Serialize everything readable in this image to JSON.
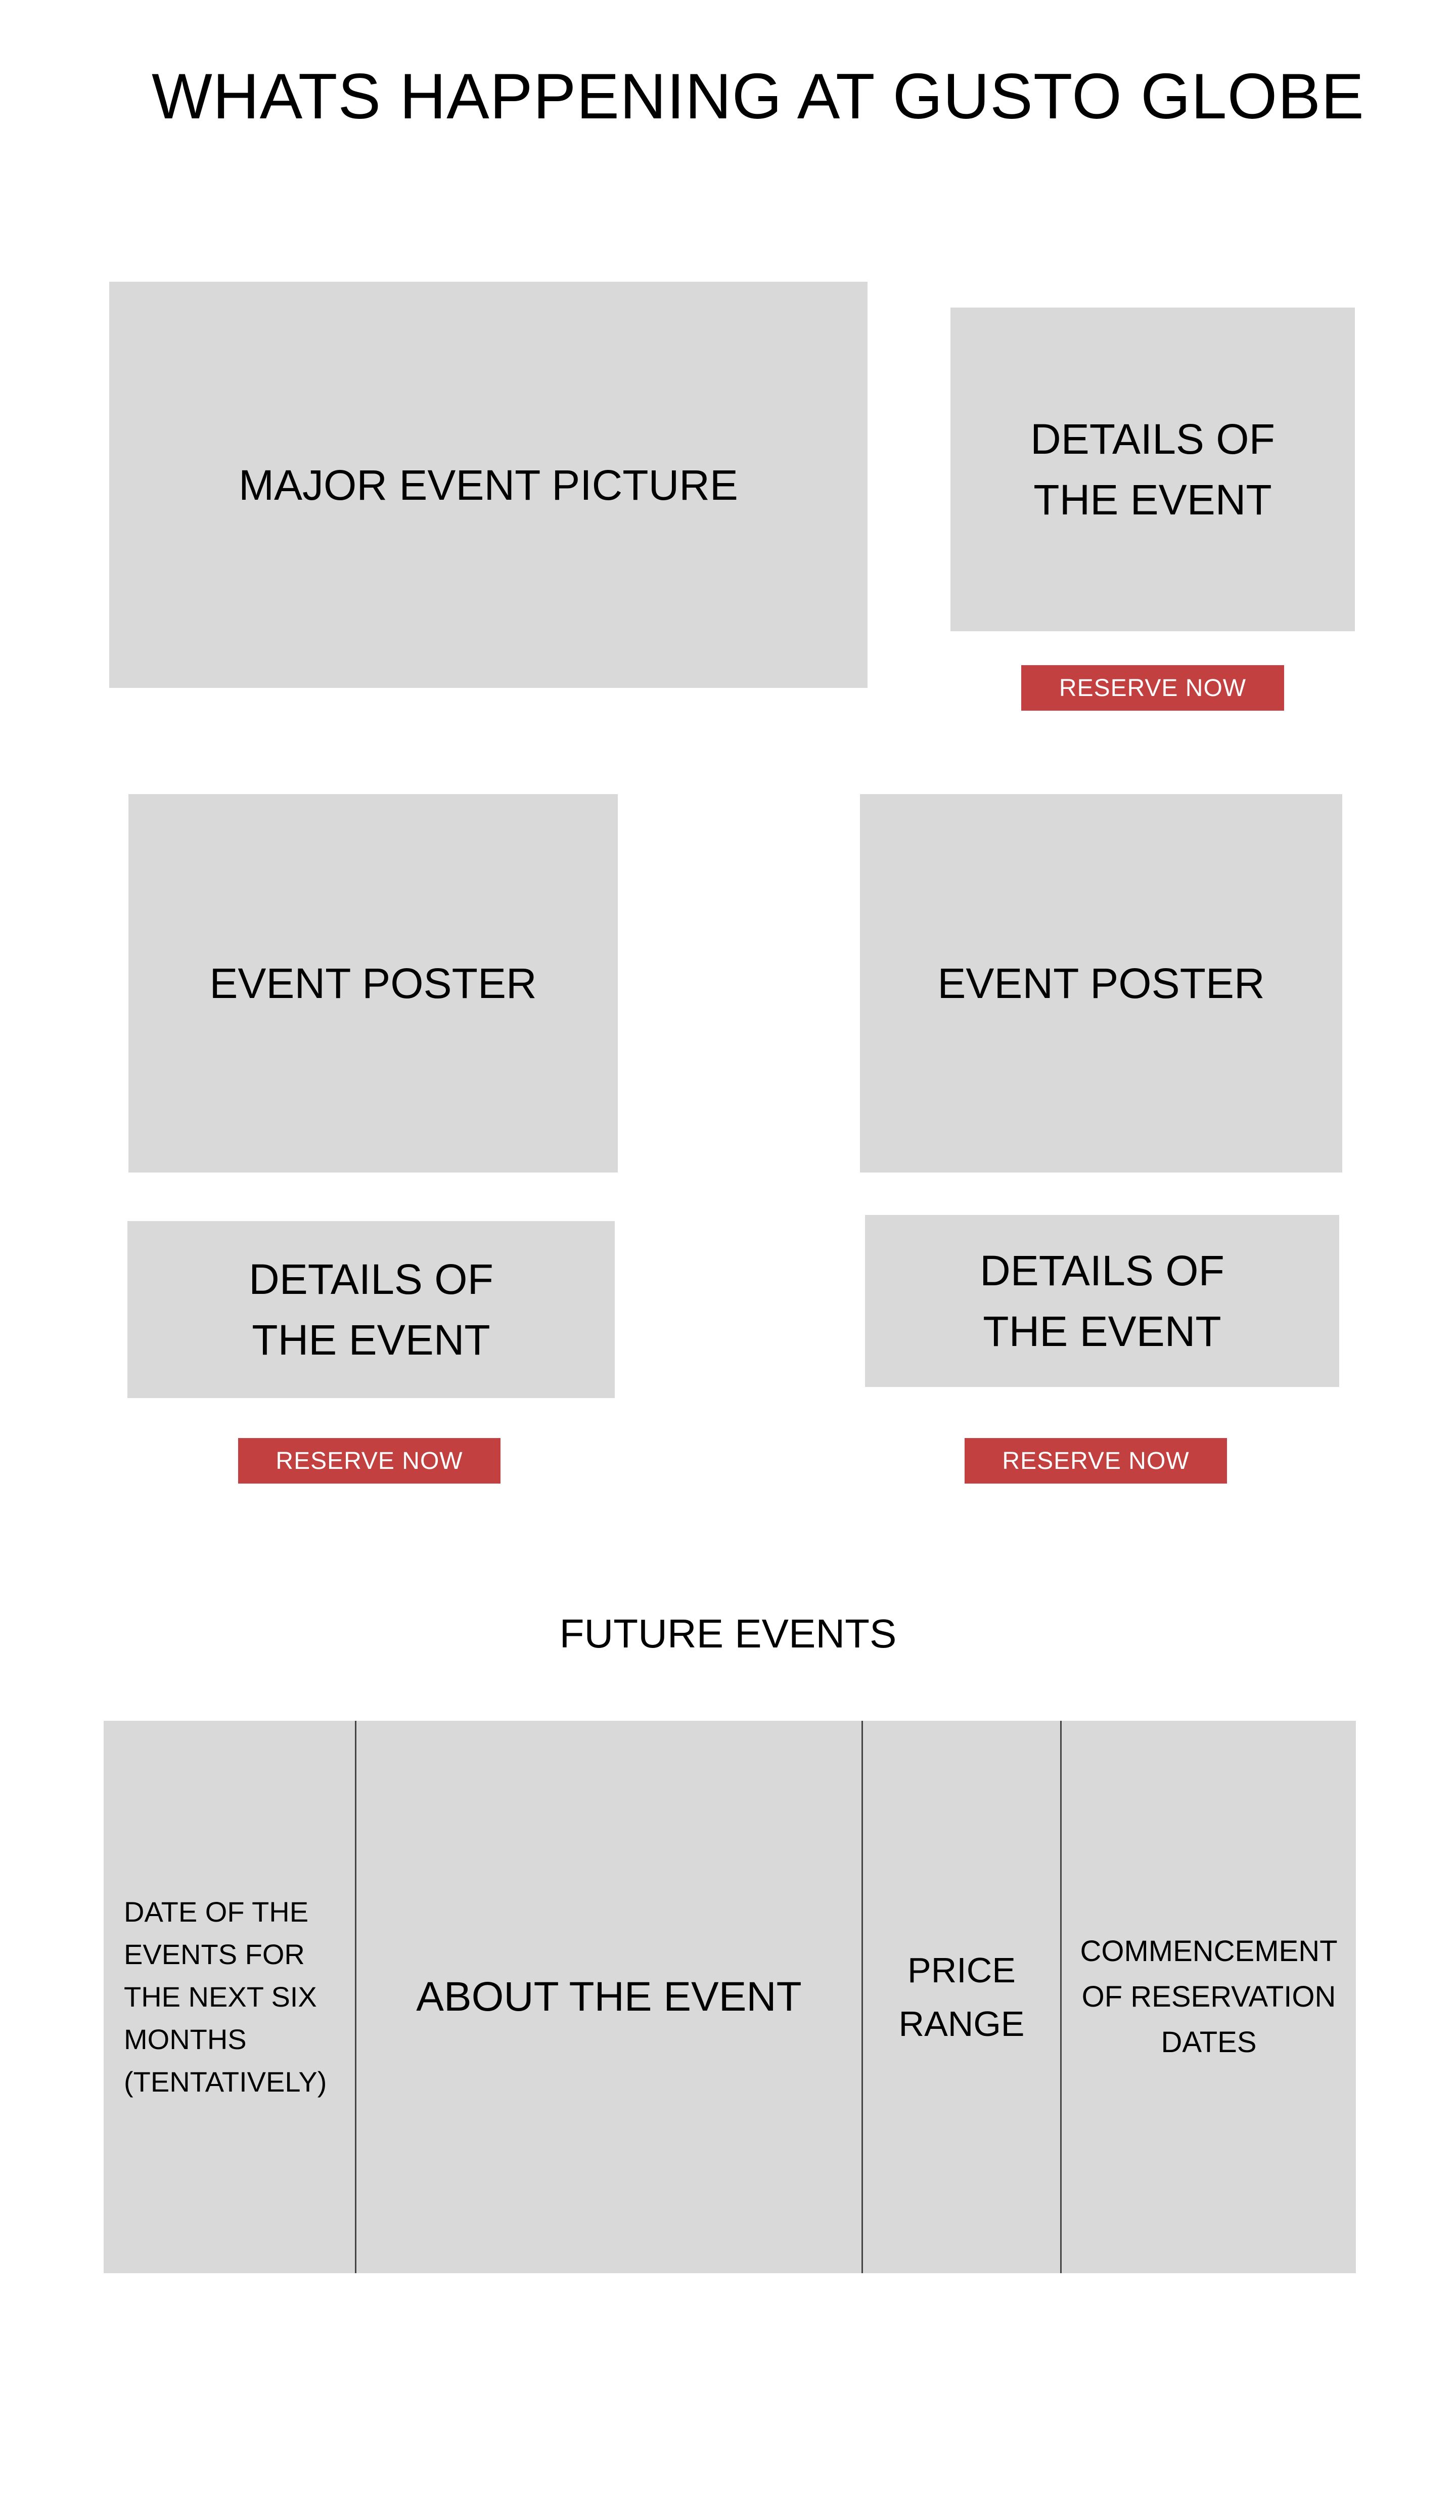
{
  "page": {
    "title": "WHATS HAPPENING AT GUSTO GLOBE"
  },
  "featured": {
    "picture_label": "MAJOR EVENT PICTURE",
    "details_label": "DETAILS OF\nTHE EVENT",
    "reserve_label": "RESERVE NOW"
  },
  "events": [
    {
      "poster_label": "EVENT POSTER",
      "details_label": "DETAILS OF\nTHE EVENT",
      "reserve_label": "RESERVE NOW"
    },
    {
      "poster_label": "EVENT POSTER",
      "details_label": "DETAILS OF\nTHE EVENT",
      "reserve_label": "RESERVE NOW"
    }
  ],
  "future_events": {
    "title": "FUTURE EVENTS",
    "columns": [
      "DATE OF THE\nEVENTS FOR\nTHE NEXT SIX\nMONTHS\n(TENTATIVELY)",
      "ABOUT THE EVENT",
      "PRICE\nRANGE",
      "COMMENCEMENT\nOF RESERVATION\nDATES"
    ]
  },
  "colors": {
    "placeholder_gray": "#d9d9d9",
    "reserve_button_red": "#c24140",
    "button_text": "#ffffff"
  }
}
